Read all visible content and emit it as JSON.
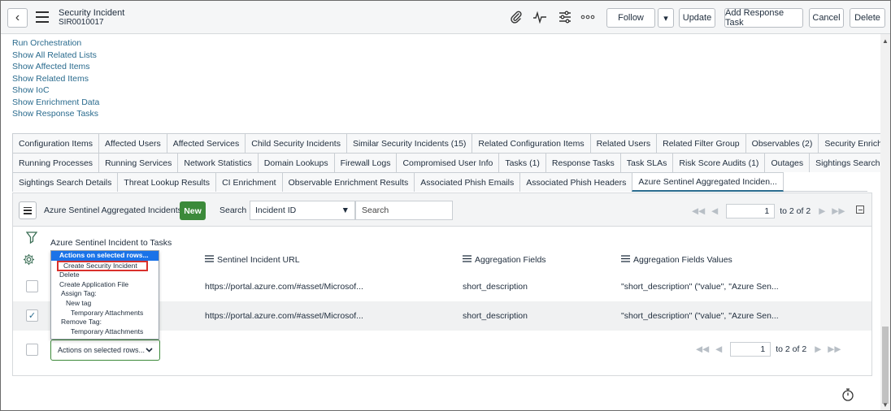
{
  "header": {
    "back_glyph": "‹",
    "title": "Security Incident",
    "number": "SIR0010017",
    "icons": [
      "paperclip-icon",
      "activity-icon",
      "sliders-icon",
      "more-icon"
    ],
    "buttons": {
      "follow": "Follow",
      "follow_dropdown": "▾",
      "update": "Update",
      "add_response_task": "Add Response Task",
      "cancel": "Cancel",
      "delete": "Delete"
    }
  },
  "related_links": [
    "Run Orchestration",
    "Show All Related Lists",
    "Show Affected Items",
    "Show Related Items",
    "Show IoC",
    "Show Enrichment Data",
    "Show Response Tasks"
  ],
  "tabs": {
    "row1": [
      "Configuration Items",
      "Affected Users",
      "Affected Services",
      "Child Security Incidents",
      "Similar Security Incidents (15)",
      "Related Configuration Items",
      "Related Users",
      "Related Filter Group",
      "Observables (2)",
      "Security Enrichment Data"
    ],
    "row2": [
      "Running Processes",
      "Running Services",
      "Network Statistics",
      "Domain Lookups",
      "Firewall Logs",
      "Compromised User Info",
      "Tasks (1)",
      "Response Tasks",
      "Task SLAs",
      "Risk Score Audits (1)",
      "Outages",
      "Sightings Search Results"
    ],
    "row3": [
      "Sightings Search Details",
      "Threat Lookup Results",
      "CI Enrichment",
      "Observable Enrichment Results",
      "Associated Phish Emails",
      "Associated Phish Headers",
      "Azure Sentinel Aggregated Inciden..."
    ],
    "active": "Azure Sentinel Aggregated Inciden..."
  },
  "list": {
    "title": "Azure Sentinel Aggregated Incidents",
    "new_label": "New",
    "search_label": "Search",
    "search_field": "Incident ID",
    "search_placeholder": "Search",
    "pager_first": "◀◀",
    "pager_prev": "◀",
    "pager_next": "▶",
    "pager_last": "▶▶",
    "page": "1",
    "range": "to 2 of 2",
    "breadcrumb": "Azure Sentinel Incident to Tasks",
    "columns": [
      "Sentinel Incident URL",
      "Aggregation Fields",
      "Aggregation Fields Values"
    ],
    "rows": [
      {
        "checked": false,
        "url": "https://portal.azure.com/#asset/Microsof...",
        "fields": "short_description",
        "values": "\"short_description\" (\"value\", \"Azure Sen..."
      },
      {
        "checked": true,
        "url": "https://portal.azure.com/#asset/Microsof...",
        "fields": "short_description",
        "values": "\"short_description\" (\"value\", \"Azure Sen..."
      }
    ],
    "check_glyph": "✓",
    "actions_select": "Actions on selected rows...",
    "actions_caret": "⌄"
  },
  "actions_menu": [
    {
      "label": "Actions on selected rows...",
      "kind": "highlight"
    },
    {
      "label": "Create Security Incident",
      "kind": "boxed"
    },
    {
      "label": "Delete",
      "kind": "item"
    },
    {
      "label": "Create Application File",
      "kind": "item"
    },
    {
      "label": "Assign Tag:",
      "kind": "grp"
    },
    {
      "label": "New tag",
      "kind": "l2"
    },
    {
      "label": "Temporary Attachments",
      "kind": "l3"
    },
    {
      "label": "Remove Tag:",
      "kind": "grp"
    },
    {
      "label": "Temporary Attachments",
      "kind": "l3"
    }
  ],
  "colors": {
    "link": "#2a6b8e",
    "new_button": "#3c8a3a",
    "menu_highlight": "#1a73e8",
    "menu_box": "#d9302c"
  }
}
